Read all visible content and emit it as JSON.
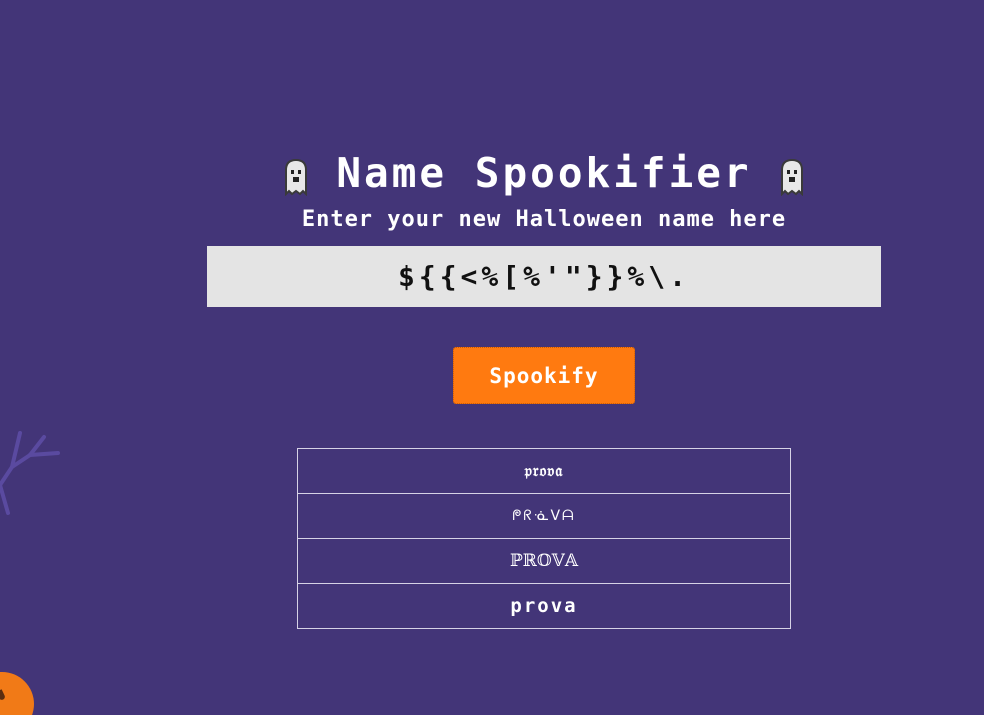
{
  "theme": {
    "background": "#433578",
    "accent": "#ff7a10",
    "input_background": "#e4e4e4"
  },
  "header": {
    "title": "Name Spookifier",
    "subtitle": "Enter your new Halloween name here",
    "left_icon": "ghost-icon",
    "right_icon": "ghost-icon"
  },
  "form": {
    "name_value": "${{<%[%'\"}}%\\.",
    "submit_label": "Spookify"
  },
  "results": [
    {
      "text": "𝔭𝔯𝔬𝔳𝔞"
    },
    {
      "text": "ᖘᖇᓍᐯᗩ"
    },
    {
      "text": "ℙℝ𝕆𝕍𝔸"
    },
    {
      "text": "prova"
    }
  ],
  "decorations": [
    "tree-branch",
    "pumpkin"
  ]
}
